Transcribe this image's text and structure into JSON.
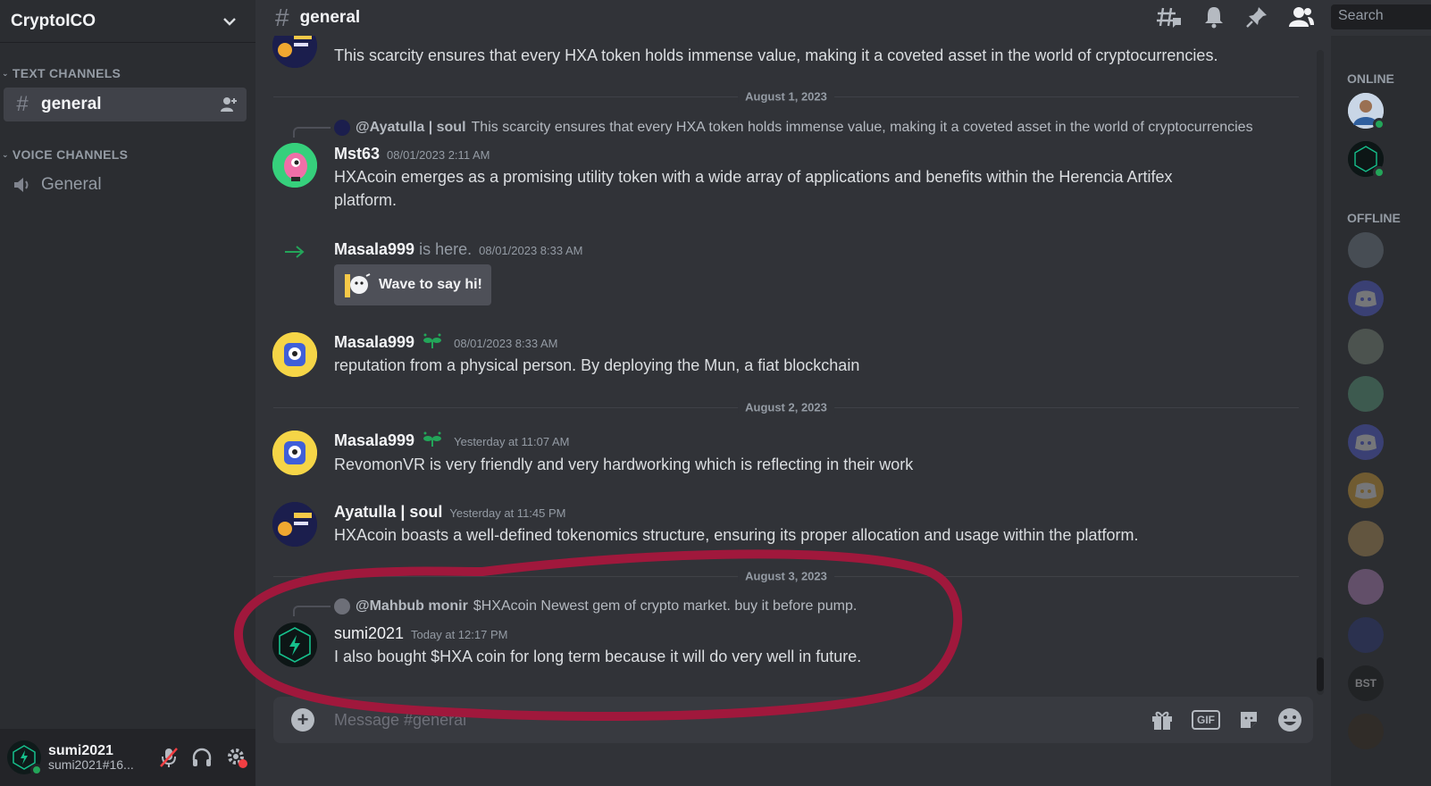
{
  "server": {
    "name": "CryptoICO"
  },
  "categories": {
    "text": "TEXT CHANNELS",
    "voice": "VOICE CHANNELS"
  },
  "channels": {
    "text_active": "general",
    "voice": "General"
  },
  "header": {
    "channel": "general",
    "search_placeholder": "Search"
  },
  "messages": {
    "top_text": "This scarcity ensures that every HXA token holds immense value, making it a coveted asset in the world of cryptocurrencies.",
    "div1": "August 1, 2023",
    "m1_reply_name": "@Ayatulla | soul",
    "m1_reply_text": "This scarcity ensures that every HXA token holds immense value, making it a coveted asset in the world of cryptocurrencies",
    "m1_author": "Mst63",
    "m1_ts": "08/01/2023 2:11 AM",
    "m1_line1": "HXAcoin emerges as a promising utility token with a wide array of applications and benefits within the Herencia Artifex",
    "m1_line2": "platform.",
    "join_author": "Masala999",
    "join_text": "is here.",
    "join_ts": "08/01/2023 8:33 AM",
    "wave_label": "Wave to say hi!",
    "m2_author": "Masala999",
    "m2_ts": "08/01/2023 8:33 AM",
    "m2_text": "reputation from a physical person. By deploying the Mun, a fiat blockchain",
    "div2": "August 2, 2023",
    "m3_author": "Masala999",
    "m3_ts": "Yesterday at 11:07 AM",
    "m3_text": "RevomonVR is very friendly and very hardworking which is reflecting in their work",
    "m4_author": "Ayatulla | soul",
    "m4_ts": "Yesterday at 11:45 PM",
    "m4_text": "HXAcoin boasts a well-defined tokenomics structure, ensuring its proper allocation and usage within the platform.",
    "div3": "August 3, 2023",
    "m5_reply_name": "@Mahbub monir",
    "m5_reply_text": "$HXAcoin Newest gem of crypto market. buy it before pump.",
    "m5_author": "sumi2021",
    "m5_ts": "Today at 12:17 PM",
    "m5_text": "I also bought $HXA coin for long term because it will do very well in future."
  },
  "input": {
    "placeholder": "Message #general",
    "gif": "GIF"
  },
  "user": {
    "name": "sumi2021",
    "tag": "sumi2021#16..."
  },
  "members": {
    "online_head": "ONLINE",
    "offline_head": "OFFLINE",
    "bst_label": "BST"
  },
  "colors": {
    "accent_green": "#23a559",
    "annotation": "#a0183c",
    "blurple": "#5865f2"
  }
}
